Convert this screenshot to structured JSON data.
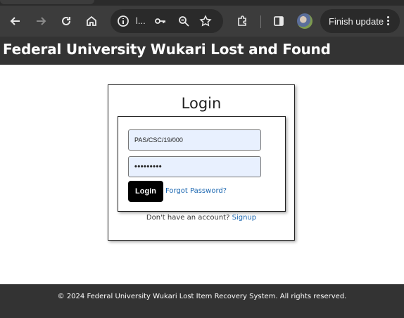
{
  "browser": {
    "omnibox_text": "l...",
    "finish_update_label": "Finish update",
    "icons": [
      "back-icon",
      "forward-icon",
      "reload-icon",
      "home-icon",
      "site-info-icon",
      "key-icon",
      "zoom-icon",
      "star-icon",
      "extensions-icon",
      "side-panel-icon",
      "profile-avatar",
      "more-menu-icon"
    ]
  },
  "header": {
    "title": "Federal University Wukari Lost and Found"
  },
  "login": {
    "heading": "Login",
    "username_value": "PAS/CSC/19/000",
    "password_value": "•••••••••",
    "button_label": "Login",
    "forgot_label": "Forgot Password?",
    "signup_prompt": "Don't have an account?",
    "signup_label": "Signup"
  },
  "footer": {
    "text": "© 2024 Federal University Wukari Lost Item Recovery System. All rights reserved."
  },
  "colors": {
    "header_bg": "#333333",
    "link": "#1a66b0",
    "input_bg": "#e8f0fe",
    "button_bg": "#000000"
  }
}
